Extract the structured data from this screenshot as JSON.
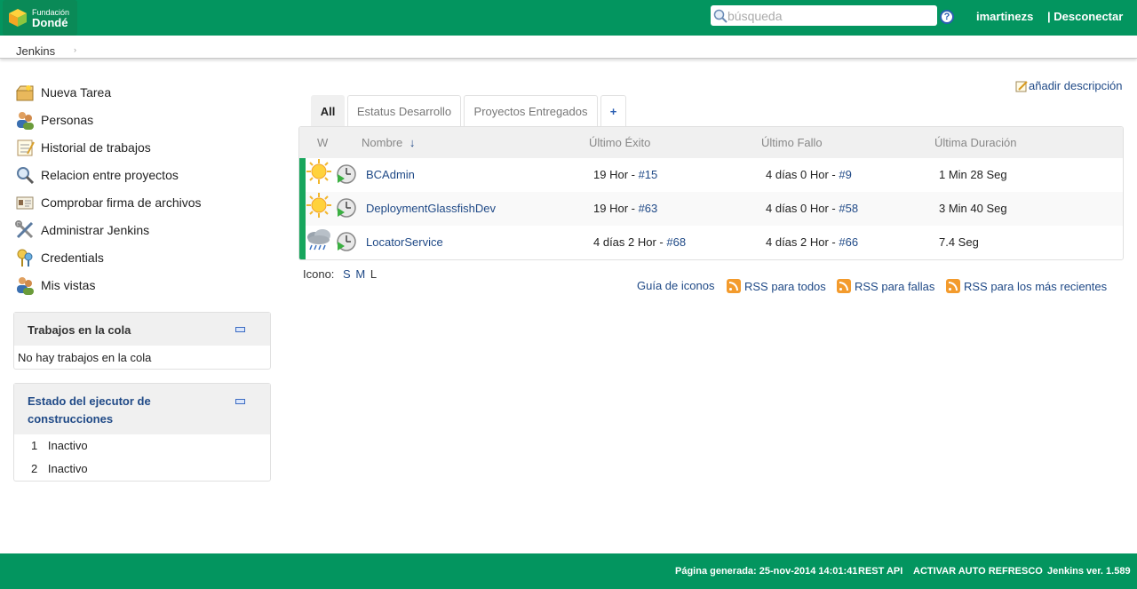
{
  "header": {
    "logo_small": "Fundación",
    "logo_big": "Dondé",
    "search_placeholder": "búsqueda",
    "help_label": "?",
    "user": "imartinezs",
    "logout": "| Desconectar"
  },
  "breadcrumb": {
    "item": "Jenkins",
    "arrow": "›"
  },
  "tasks": [
    {
      "label": "Nueva Tarea",
      "icon": "new-package-icon"
    },
    {
      "label": "Personas",
      "icon": "people-icon"
    },
    {
      "label": "Historial de trabajos",
      "icon": "notepad-icon"
    },
    {
      "label": "Relacion entre proyectos",
      "icon": "magnifier-icon"
    },
    {
      "label": "Comprobar firma de archivos",
      "icon": "fingerprint-icon"
    },
    {
      "label": "Administrar Jenkins",
      "icon": "tools-icon"
    },
    {
      "label": "Credentials",
      "icon": "keys-icon"
    },
    {
      "label": "Mis vistas",
      "icon": "people-icon"
    }
  ],
  "queue": {
    "title": "Trabajos en la cola",
    "empty": "No hay trabajos en la cola"
  },
  "executors": {
    "title_line1": "Estado del ejecutor de",
    "title_line2": "construcciones",
    "rows": [
      {
        "num": "1",
        "state": "Inactivo"
      },
      {
        "num": "2",
        "state": "Inactivo"
      }
    ]
  },
  "add_description": "añadir descripción",
  "tabs": [
    "All",
    "Estatus Desarrollo",
    "Proyectos Entregados",
    "+"
  ],
  "table": {
    "headers": {
      "w": "W",
      "name": "Nombre",
      "sort_arrow": "↓",
      "last_success": "Último Éxito",
      "last_failure": "Último Fallo",
      "last_duration": "Última Duración"
    },
    "rows": [
      {
        "weather": "sunny-icon",
        "name": "BCAdmin",
        "success_time": "19 Hor - ",
        "success_build": "#15",
        "failure_time": "4 días 0 Hor - ",
        "failure_build": "#9",
        "duration": "1 Min 28 Seg"
      },
      {
        "weather": "sunny-icon",
        "name": "DeploymentGlassfishDev",
        "success_time": "19 Hor - ",
        "success_build": "#63",
        "failure_time": "4 días 0 Hor - ",
        "failure_build": "#58",
        "duration": "3 Min 40 Seg"
      },
      {
        "weather": "storm-icon",
        "name": "LocatorService",
        "success_time": "4 días 2 Hor - ",
        "success_build": "#68",
        "failure_time": "4 días 2 Hor - ",
        "failure_build": "#66",
        "duration": "7.4 Seg"
      }
    ]
  },
  "icon_size": {
    "label": "Icono:",
    "s": "S",
    "m": "M",
    "l": "L"
  },
  "links": {
    "legend": "Guía de iconos",
    "rss_all": "RSS para todos",
    "rss_failed": "RSS para fallas",
    "rss_latest": "RSS para los más recientes"
  },
  "footer": {
    "generated": "Página generada: 25-nov-2014 14:01:41",
    "rest_api": "REST API",
    "auto_refresh": "ACTIVAR AUTO REFRESCO",
    "version": "Jenkins ver. 1.589"
  },
  "colors": {
    "brand": "#03955f",
    "link": "#204a87",
    "success_stripe": "#17a65d"
  }
}
